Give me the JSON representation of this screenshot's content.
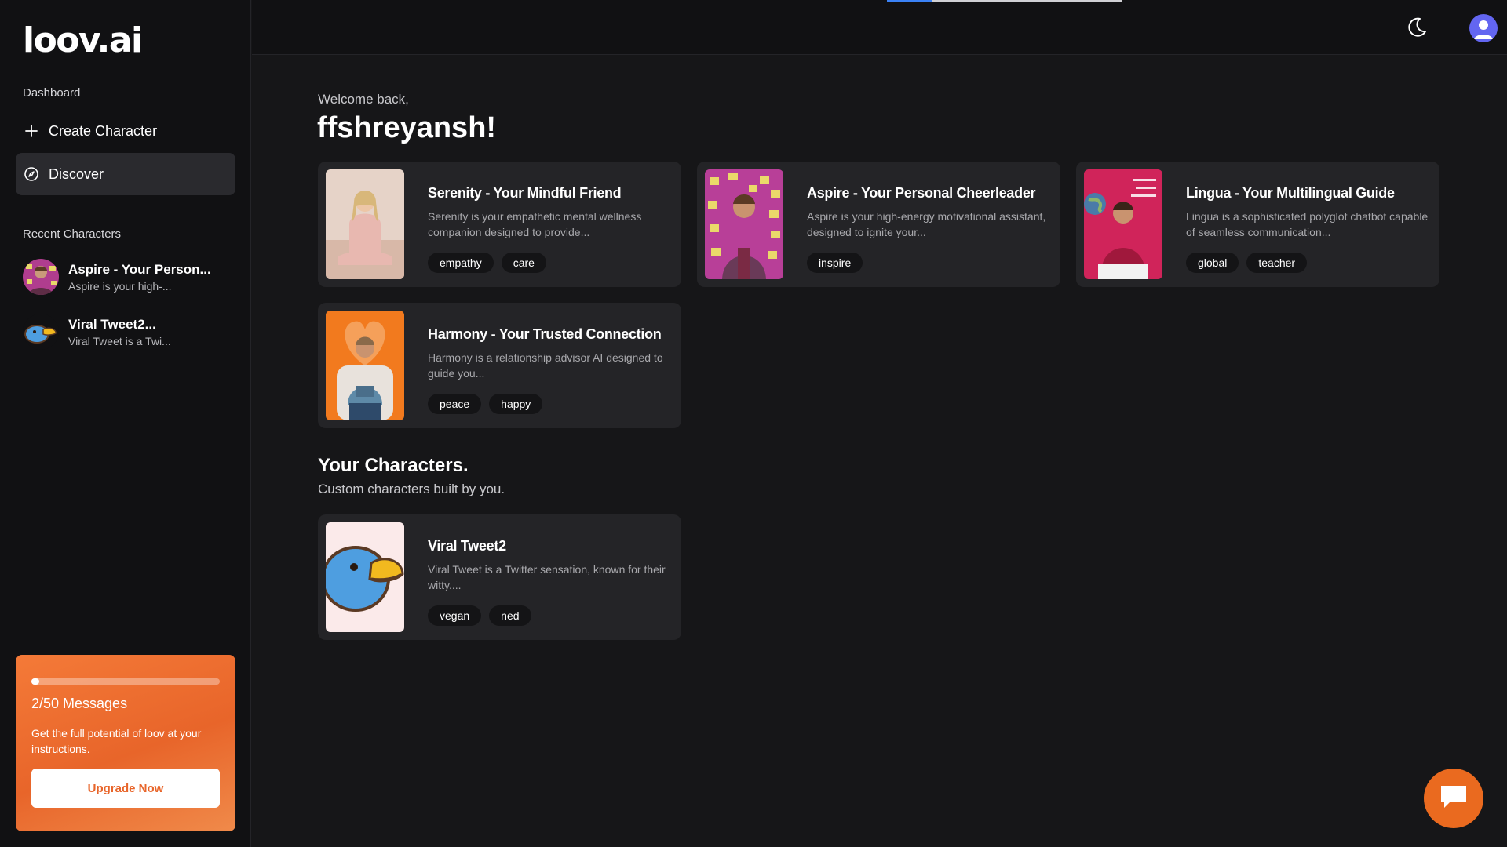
{
  "app": {
    "logo": "loov.ai"
  },
  "sidebar": {
    "dashboard_label": "Dashboard",
    "nav": [
      {
        "label": "Create Character",
        "icon": "plus-icon"
      },
      {
        "label": "Discover",
        "icon": "compass-icon",
        "active": true
      }
    ],
    "recent_label": "Recent Characters",
    "recent": [
      {
        "title": "Aspire - Your Person...",
        "subtitle": "Aspire is your high-..."
      },
      {
        "title": "Viral Tweet2...",
        "subtitle": "Viral Tweet is a Twi..."
      }
    ],
    "upgrade": {
      "messages": "2/50 Messages",
      "progress": 0.04,
      "text": "Get the full potential of loov at your instructions.",
      "button": "Upgrade Now"
    }
  },
  "topbar": {
    "theme_icon": "moon-icon",
    "profile_icon": "user-avatar-icon"
  },
  "main": {
    "welcome": "Welcome back,",
    "username": "ffshreyansh!",
    "characters": [
      {
        "title": "Serenity - Your Mindful Friend",
        "description": "Serenity is your empathetic mental wellness companion designed to provide...",
        "tags": [
          "empathy",
          "care"
        ]
      },
      {
        "title": "Aspire - Your Personal Cheerleader",
        "description": "Aspire is your high-energy motivational assistant, designed to ignite your...",
        "tags": [
          "inspire"
        ]
      },
      {
        "title": "Lingua - Your Multilingual Guide",
        "description": "Lingua is a sophisticated polyglot chatbot capable of seamless communication...",
        "tags": [
          "global",
          "teacher"
        ]
      },
      {
        "title": "Harmony - Your Trusted Connection",
        "description": "Harmony is a relationship advisor AI designed to guide you...",
        "tags": [
          "peace",
          "happy"
        ]
      }
    ],
    "your_characters": {
      "title": "Your Characters.",
      "subtitle": "Custom characters built by you.",
      "items": [
        {
          "title": "Viral Tweet2",
          "description": "Viral Tweet is a Twitter sensation, known for their witty....",
          "tags": [
            "vegan",
            "ned"
          ]
        }
      ]
    }
  },
  "chat_fab": {
    "icon": "chat-bubble-icon"
  },
  "colors": {
    "accent": "#e8652a",
    "background": "#161618",
    "sidebar": "#111113",
    "card": "#242427",
    "tag": "#141416"
  }
}
